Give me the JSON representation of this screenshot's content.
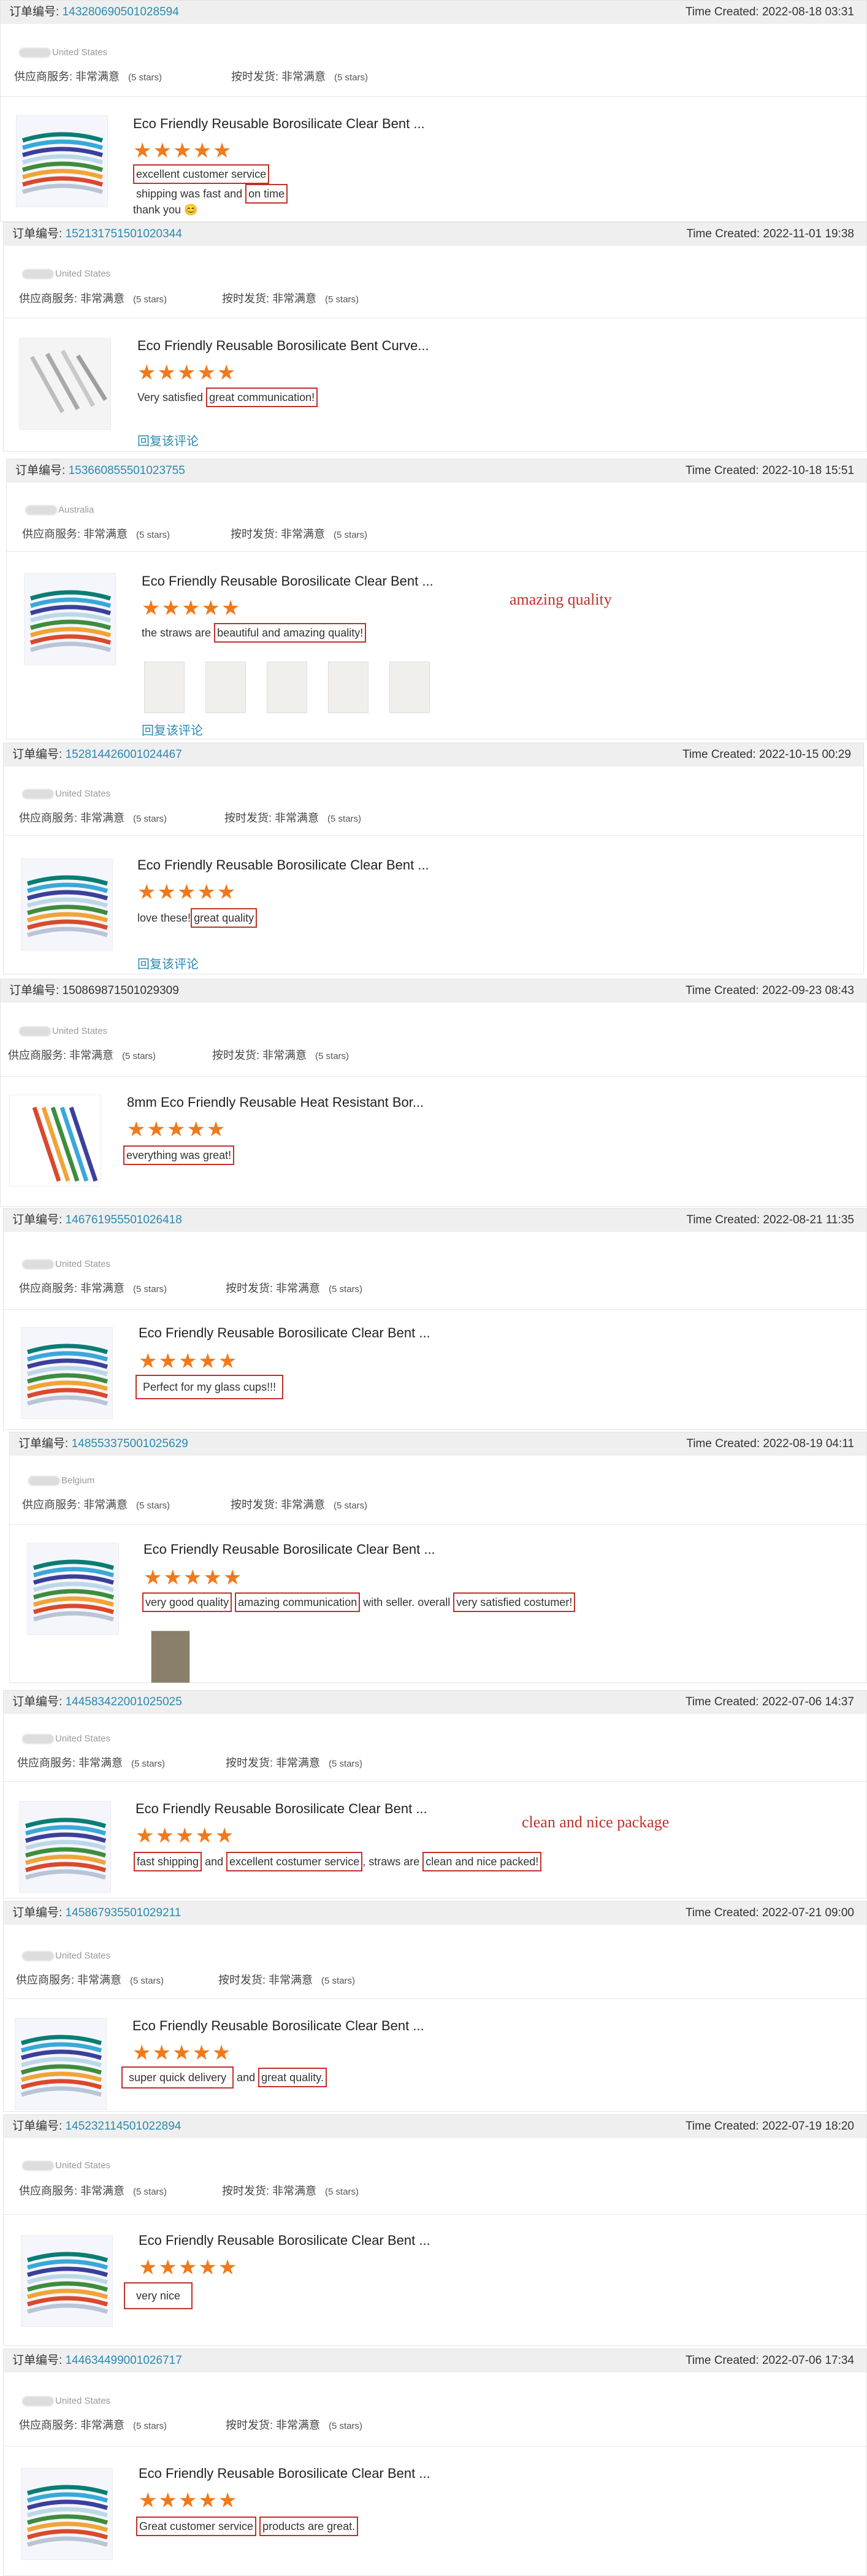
{
  "common": {
    "order_label": "订单编号:",
    "time_label": "Time Created:",
    "svc_label": "供应商服务:",
    "delivery_label": "按时发货:",
    "rating_word": "非常满意",
    "stars_label": "(5 stars)",
    "stars_glyphs": "★★★★★",
    "reply_label": "回复该评论"
  },
  "reviews": [
    {
      "order": "1432806905010285​94",
      "time": "2022-08-18 03:31",
      "location": "United States",
      "product": "Eco Friendly Reusable Borosilicate Clear Bent ...",
      "text_a": "excellent customer service",
      "text_b": "shipping was fast and",
      "text_c": "on time",
      "text_d": "thank you 😊"
    },
    {
      "order": "152131751501020344",
      "time": "2022-11-01 19:38",
      "location": "United States",
      "product": "Eco Friendly Reusable Borosilicate Bent Curve...",
      "text_a": "Very satisfied",
      "text_b": "great communication!"
    },
    {
      "order": "153660855501023755",
      "time": "2022-10-18 15:51",
      "location": "Australia",
      "product": "Eco Friendly Reusable Borosilicate Clear Bent ...",
      "text_a": "the straws are",
      "text_b": "beautiful and amazing quality!",
      "note": "amazing quality"
    },
    {
      "order": "152814426001024467",
      "time": "2022-10-15 00:29",
      "location": "United States",
      "product": "Eco Friendly Reusable Borosilicate Clear Bent ...",
      "text_a": "love these!",
      "text_b": "great quality"
    },
    {
      "order": "150869871501029309",
      "time": "2022-09-23 08:43",
      "location": "United States",
      "product": "8mm Eco Friendly Reusable Heat Resistant Bor...",
      "text_a": "everything was great!"
    },
    {
      "order": "146761955501026418",
      "time": "2022-08-21 11:35",
      "location": "United States",
      "product": "Eco Friendly Reusable Borosilicate Clear Bent ...",
      "text_a": "Perfect for my glass cups!!!"
    },
    {
      "order": "148553375001025629",
      "time": "2022-08-19 04:11",
      "location": "Belgium",
      "product": "Eco Friendly Reusable Borosilicate Clear Bent ...",
      "text_a": "very good quality",
      "text_b": "amazing communication",
      "text_c": "with seller.  overall",
      "text_d": "very satisfied costumer!"
    },
    {
      "order": "144583422001025025",
      "time": "2022-07-06 14:37",
      "location": "United States",
      "product": "Eco Friendly Reusable Borosilicate Clear Bent ...",
      "text_a": "fast shipping",
      "text_b": "and",
      "text_c": "excellent costumer service",
      "text_d": ", straws are",
      "text_e": "clean and nice packed!",
      "note": "clean and nice package"
    },
    {
      "order": "145867935501029211",
      "time": "2022-07-21 09:00",
      "location": "United States",
      "product": "Eco Friendly Reusable Borosilicate Clear Bent ...",
      "text_a": "super quick delivery",
      "text_b": "and",
      "text_c": "great quality."
    },
    {
      "order": "145232114501022894",
      "time": "2022-07-19 18:20",
      "location": "United States",
      "product": "Eco Friendly Reusable Borosilicate Clear Bent ...",
      "text_a": "very nice"
    },
    {
      "order": "144634499001026717",
      "time": "2022-07-06 17:34",
      "location": "United States",
      "product": "Eco Friendly Reusable Borosilicate Clear Bent ...",
      "text_a": "Great customer service",
      "text_b": "products are great."
    }
  ]
}
